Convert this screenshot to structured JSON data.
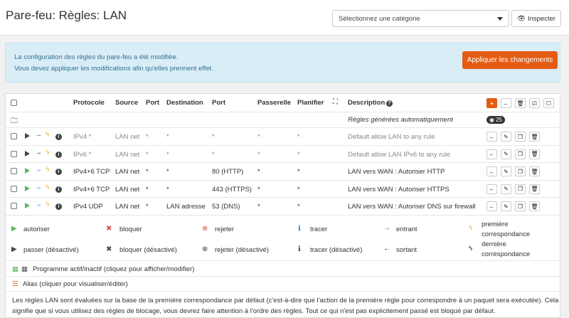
{
  "header": {
    "title": "Pare-feu: Règles: LAN",
    "category_placeholder": "Sélectionnez une catégorie",
    "inspect_label": "Inspecter"
  },
  "alert": {
    "line1": "La configuration des règles du pare-feu a été modifiée.",
    "line2": "Vous devez appliquer les modifications afin qu'elles prennent effet.",
    "apply_label": "Appliquer les changements"
  },
  "table": {
    "headers": {
      "protocol": "Protocole",
      "source": "Source",
      "port": "Port",
      "destination": "Destination",
      "dport": "Port",
      "gateway": "Passerelle",
      "schedule": "Planifier",
      "description": "Description"
    },
    "auto_rules": {
      "label": "Règles générées automatiquement",
      "count": "25"
    },
    "rules": [
      {
        "protocol": "IPv4 *",
        "source": "LAN net",
        "port": "*",
        "destination": "*",
        "dport": "*",
        "gateway": "*",
        "schedule": "*",
        "description": "Default allow LAN to any rule",
        "enabled": false
      },
      {
        "protocol": "IPv6 *",
        "source": "LAN net",
        "port": "*",
        "destination": "*",
        "dport": "*",
        "gateway": "*",
        "schedule": "*",
        "description": "Default allow LAN IPv6 to any rule",
        "enabled": false
      },
      {
        "protocol": "IPv4+6 TCP",
        "source": "LAN net",
        "port": "*",
        "destination": "*",
        "dport": "80 (HTTP)",
        "gateway": "*",
        "schedule": "*",
        "description": "LAN vers WAN : Autoriser HTTP",
        "enabled": true
      },
      {
        "protocol": "IPv4+6 TCP",
        "source": "LAN net",
        "port": "*",
        "destination": "*",
        "dport": "443 (HTTPS)",
        "gateway": "*",
        "schedule": "*",
        "description": "LAN vers WAN : Autoriser HTTPS",
        "enabled": true
      },
      {
        "protocol": "IPv4 UDP",
        "source": "LAN net",
        "port": "*",
        "destination": "LAN adresse",
        "dport": "53 (DNS)",
        "gateway": "*",
        "schedule": "*",
        "description": "LAN vers WAN : Autoriser DNS sur firewall",
        "enabled": true
      }
    ]
  },
  "legend": {
    "pass": "autoriser",
    "block": "bloquer",
    "reject": "rejeter",
    "log": "tracer",
    "in": "entrant",
    "first_match_1": "première",
    "first_match_2": "correspondance",
    "pass_disabled": "passer (désactivé)",
    "block_disabled": "bloquer (désactivé)",
    "reject_disabled": "rejeter (désactivé)",
    "log_disabled": "tracer (désactivé)",
    "out": "sortant",
    "last_match_1": "dernière",
    "last_match_2": "correspondance",
    "schedule": "Programme actif/inactif (cliquez pour afficher/modifier)",
    "alias": "Alias (cliquer pour visualiser/éditer)",
    "note1": "Les règles LAN sont évaluées sur la base de la première correspondance par défaut (c'est-à-dire que l'action de la première règle pour correspondre à un paquet sera exécutée). Cela",
    "note2": "signifie que si vous utilisez des règles de blocage, vous devrez faire attention à l'ordre des règles. Tout ce qui n'est pas explicitement passé est bloqué par défaut."
  }
}
